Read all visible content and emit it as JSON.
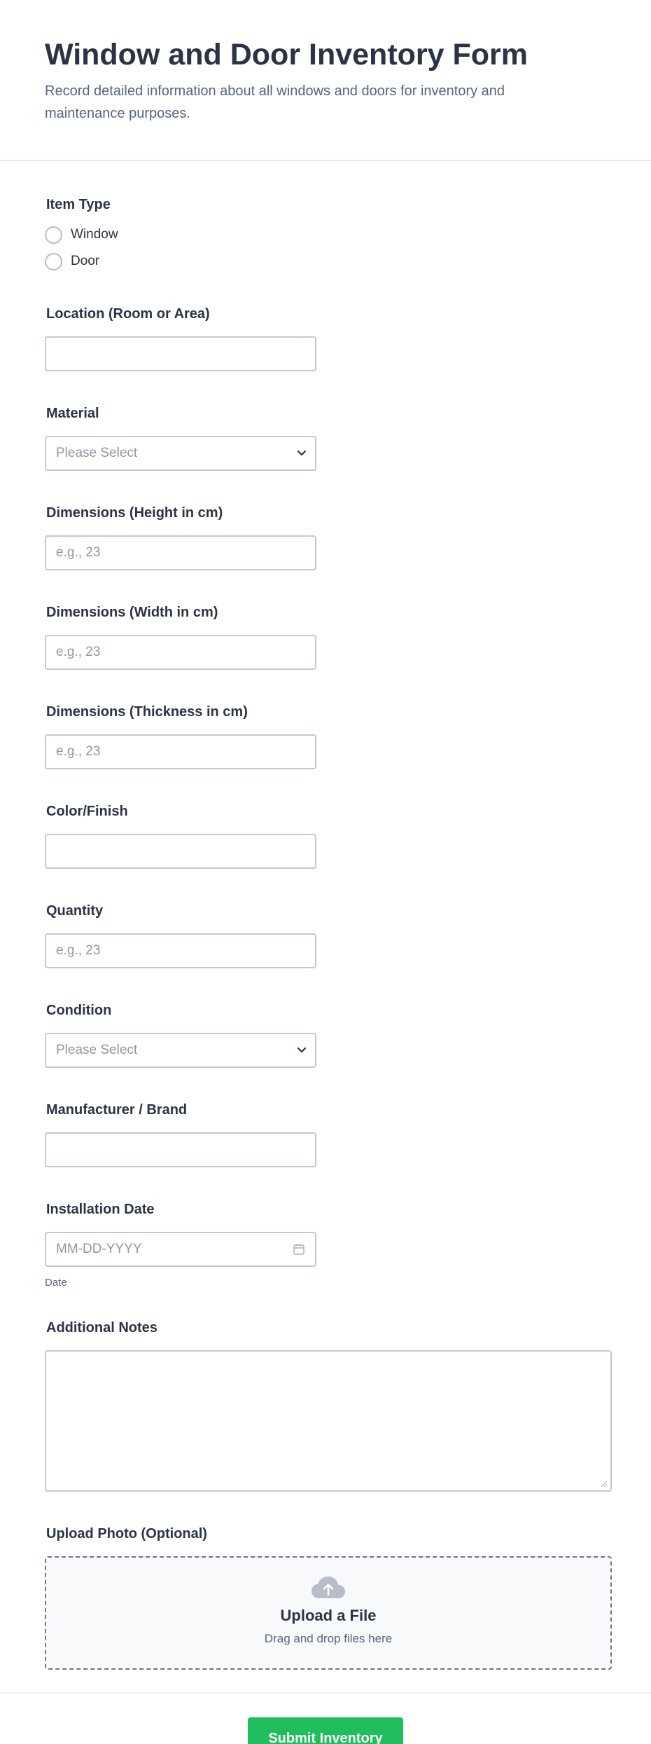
{
  "form": {
    "title": "Window and Door Inventory Form",
    "subtitle": "Record detailed information about all windows and doors for inventory and maintenance purposes."
  },
  "fields": {
    "item_type": {
      "label": "Item Type",
      "options": [
        "Window",
        "Door"
      ]
    },
    "location": {
      "label": "Location (Room or Area)",
      "value": ""
    },
    "material": {
      "label": "Material",
      "placeholder": "Please Select"
    },
    "height": {
      "label": "Dimensions (Height in cm)",
      "placeholder": "e.g., 23"
    },
    "width": {
      "label": "Dimensions (Width in cm)",
      "placeholder": "e.g., 23"
    },
    "thickness": {
      "label": "Dimensions (Thickness in cm)",
      "placeholder": "e.g., 23"
    },
    "color": {
      "label": "Color/Finish",
      "value": ""
    },
    "quantity": {
      "label": "Quantity",
      "placeholder": "e.g., 23"
    },
    "condition": {
      "label": "Condition",
      "placeholder": "Please Select"
    },
    "manufacturer": {
      "label": "Manufacturer / Brand",
      "value": ""
    },
    "install_date": {
      "label": "Installation Date",
      "placeholder": "MM-DD-YYYY",
      "sublabel": "Date"
    },
    "notes": {
      "label": "Additional Notes",
      "value": ""
    },
    "upload": {
      "label": "Upload Photo (Optional)",
      "title": "Upload a File",
      "subtitle": "Drag and drop files here"
    }
  },
  "submit": {
    "label": "Submit Inventory"
  },
  "icons": {
    "select": "chevron-down-icon",
    "date": "calendar-icon",
    "upload": "cloud-upload-icon"
  },
  "colors": {
    "submit": "#1fbd5c",
    "text": "#2c3345",
    "muted": "#57647e"
  }
}
